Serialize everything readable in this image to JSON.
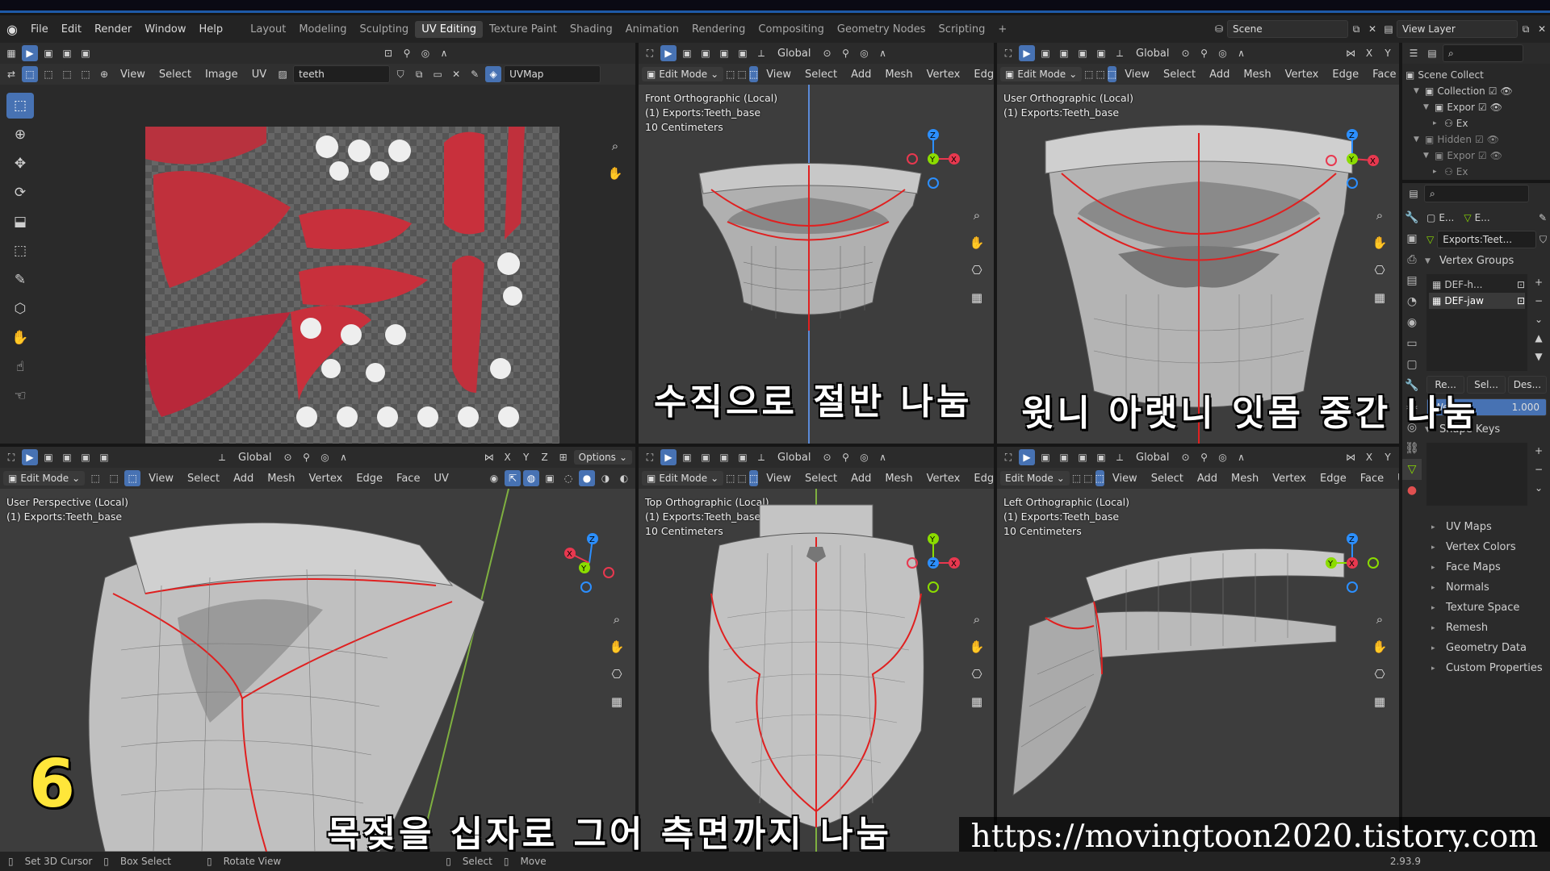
{
  "menubar": {
    "menus": [
      "File",
      "Edit",
      "Render",
      "Window",
      "Help"
    ],
    "workspaces": [
      "Layout",
      "Modeling",
      "Sculpting",
      "UV Editing",
      "Texture Paint",
      "Shading",
      "Animation",
      "Rendering",
      "Compositing",
      "Geometry Nodes",
      "Scripting"
    ],
    "active_workspace": "UV Editing",
    "scene_value": "Scene",
    "view_layer_value": "View Layer"
  },
  "uv_editor": {
    "menus": [
      "View",
      "Select",
      "Image",
      "UV"
    ],
    "image_name": "teeth",
    "uv_map_name": "UVMap",
    "tools": [
      "select-box-icon",
      "cursor-icon",
      "move-icon",
      "rotate-icon",
      "scale-icon",
      "transform-icon",
      "annotate-icon",
      "rip-region-icon",
      "grab-icon",
      "relax-icon",
      "pinch-icon"
    ]
  },
  "viewports": {
    "mode_label": "Edit Mode",
    "orientation": "Global",
    "menus": [
      "View",
      "Select",
      "Add",
      "Mesh",
      "Vertex",
      "Edge",
      "Face",
      "UV"
    ],
    "object_line": "(1) Exports:Teeth_base",
    "scale_line": "10 Centimeters",
    "options_label": "Options",
    "front": {
      "title": "Front Orthographic (Local)"
    },
    "user_ortho": {
      "title": "User Orthographic (Local)"
    },
    "user_persp": {
      "title": "User Perspective (Local)"
    },
    "top": {
      "title": "Top Orthographic (Local)"
    },
    "left": {
      "title": "Left Orthographic (Local)"
    }
  },
  "captions": {
    "step_number": "6",
    "front_caption": "수직으로 절반 나눔",
    "user_caption": "윗니 아랫니 잇몸 중간 나눔",
    "bottom_caption": "목젖을 십자로 그어 측면까지 나눔",
    "watermark": "https://movingtoon2020.tistory.com"
  },
  "outliner": {
    "items": [
      {
        "label": "Scene Collect",
        "indent": 0
      },
      {
        "label": "Collection",
        "indent": 1
      },
      {
        "label": "Expor",
        "indent": 2
      },
      {
        "label": "Ex",
        "indent": 3
      },
      {
        "label": "Hidden",
        "indent": 1
      },
      {
        "label": "Expor",
        "indent": 2
      },
      {
        "label": "Ex",
        "indent": 3
      }
    ]
  },
  "properties": {
    "breadcrumb_left": "E...",
    "breadcrumb_right": "E...",
    "mesh_name": "Exports:Teet...",
    "vertex_groups_title": "Vertex Groups",
    "vertex_groups": [
      "DEF-h...",
      "DEF-jaw"
    ],
    "vg_buttons": [
      "Re...",
      "Sel...",
      "Des..."
    ],
    "weight_label": "Weight",
    "weight_value": "1.000",
    "weight_fraction": 1.0,
    "shape_keys_title": "Shape Keys",
    "sections": [
      "UV Maps",
      "Vertex Colors",
      "Face Maps",
      "Normals",
      "Texture Space",
      "Remesh",
      "Geometry Data",
      "Custom Properties"
    ]
  },
  "statusbar": {
    "items": [
      "Set 3D Cursor",
      "Box Select",
      "Rotate View",
      "Select",
      "Move"
    ],
    "version": "2.93.9"
  },
  "colors": {
    "accent": "#4772b3",
    "seam": "#e02020",
    "axis_x": "#e8384f",
    "axis_y": "#8bdc00",
    "axis_z": "#2c8fff"
  }
}
